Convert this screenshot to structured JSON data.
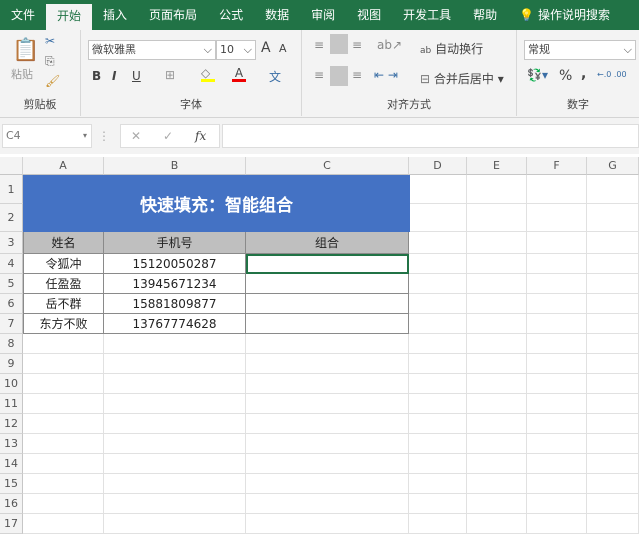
{
  "tabs": [
    "文件",
    "开始",
    "插入",
    "页面布局",
    "公式",
    "数据",
    "审阅",
    "视图",
    "开发工具",
    "帮助"
  ],
  "tell_me": "操作说明搜索",
  "ribbon": {
    "clipboard": {
      "label": "剪贴板",
      "paste": "粘贴"
    },
    "font": {
      "label": "字体",
      "name": "微软雅黑",
      "size": "10",
      "bold": "B",
      "italic": "I",
      "underline": "U",
      "grow": "A",
      "shrink": "A",
      "phonetic": "文"
    },
    "alignment": {
      "label": "对齐方式",
      "wrap": "自动换行",
      "merge": "合并后居中"
    },
    "number": {
      "label": "数字",
      "format": "常规",
      "percent": "%",
      "comma": ","
    }
  },
  "formula_bar": {
    "name_box": "C4",
    "cancel": "✕",
    "enter": "✓",
    "fx": "fx",
    "value": ""
  },
  "columns": [
    "A",
    "B",
    "C",
    "D",
    "E",
    "F",
    "G"
  ],
  "rows": [
    "1",
    "2",
    "3",
    "4",
    "5",
    "6",
    "7",
    "8",
    "9",
    "10",
    "11",
    "12",
    "13",
    "14",
    "15",
    "16",
    "17"
  ],
  "sheet": {
    "title": "快速填充：智能组合",
    "headers": [
      "姓名",
      "手机号",
      "组合"
    ],
    "data": [
      [
        "令狐冲",
        "15120050287",
        ""
      ],
      [
        "任盈盈",
        "13945671234",
        ""
      ],
      [
        "岳不群",
        "15881809877",
        ""
      ],
      [
        "东方不败",
        "13767774628",
        ""
      ]
    ]
  },
  "colors": {
    "accent": "#217346",
    "title_bg": "#4472c4",
    "header_bg": "#bfbfbf"
  }
}
